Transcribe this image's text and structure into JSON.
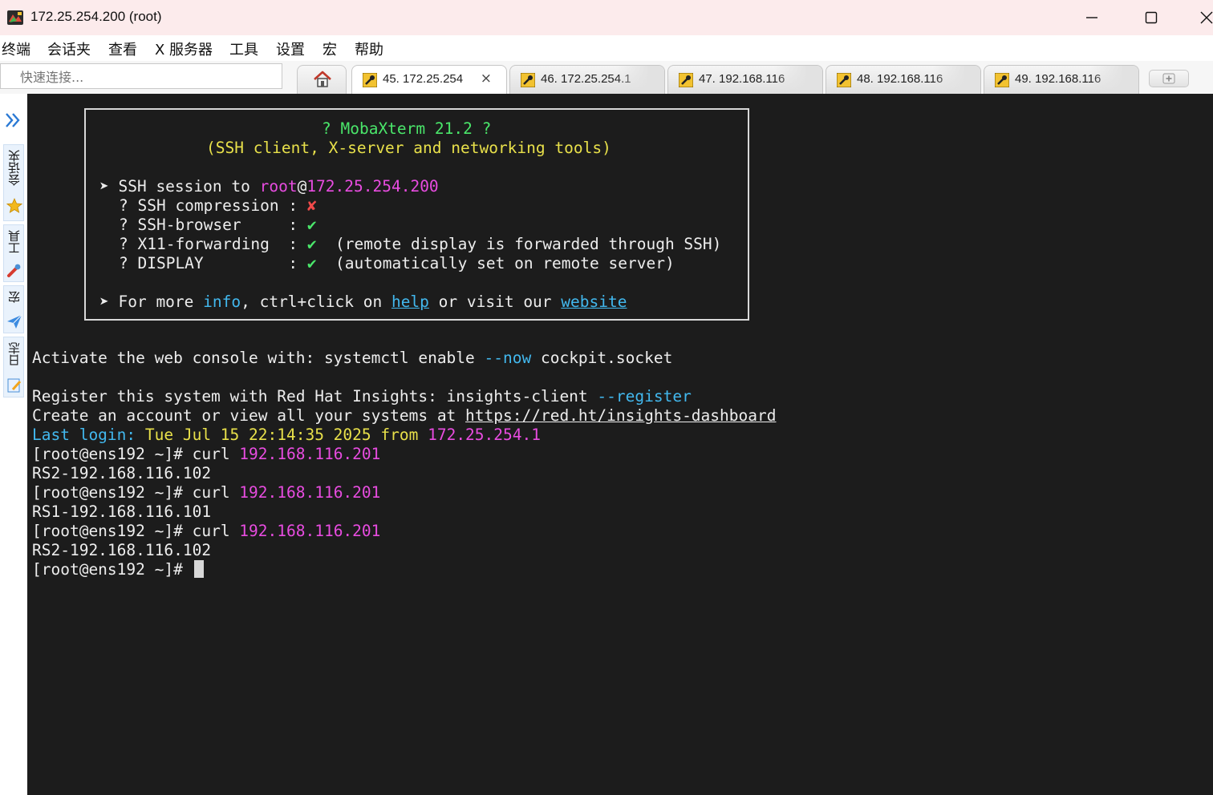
{
  "window": {
    "title": "172.25.254.200 (root)"
  },
  "menu": [
    "终端",
    "会话夹",
    "查看",
    "X 服务器",
    "工具",
    "设置",
    "宏",
    "帮助"
  ],
  "quick_connect": {
    "placeholder": "快速连接..."
  },
  "tabs": [
    {
      "label": "45. 172.25.254",
      "active": true,
      "close": "×"
    },
    {
      "label": "46. 172.25.254.1",
      "active": false
    },
    {
      "label": "47. 192.168.116",
      "active": false
    },
    {
      "label": "48. 192.168.116",
      "active": false
    },
    {
      "label": "49. 192.168.116",
      "active": false
    }
  ],
  "sidebar": {
    "sessions_label": "会话夹",
    "tools_label": "工具",
    "macros_label": "宏",
    "log_label": "日志"
  },
  "banner": {
    "title": "? MobaXterm 21.2 ?",
    "subtitle": "(SSH client, X-server and networking tools)",
    "ssh_prefix": "➤ SSH session to ",
    "ssh_user": "root",
    "ssh_at": "@",
    "ssh_host": "172.25.254.200",
    "features": [
      {
        "name": "? SSH compression : ",
        "mark": "✘",
        "note": ""
      },
      {
        "name": "? SSH-browser     : ",
        "mark": "✔",
        "note": ""
      },
      {
        "name": "? X11-forwarding  : ",
        "mark": "✔",
        "note": "  (remote display is forwarded through SSH)"
      },
      {
        "name": "? DISPLAY         : ",
        "mark": "✔",
        "note": "  (automatically set on remote server)"
      }
    ],
    "more_prefix": "➤ For more ",
    "more_info": "info",
    "more_mid": ", ctrl+click on ",
    "more_help": "help",
    "more_mid2": " or visit our ",
    "more_website": "website"
  },
  "terminal": {
    "activate_prefix": "Activate the web console with: systemctl enable ",
    "activate_flag": "--now",
    "activate_suffix": " cockpit.socket",
    "register_prefix": "Register this system with Red Hat Insights: insights-client ",
    "register_flag": "--register",
    "account_prefix": "Create an account or view all your systems at ",
    "account_url": "https://red.ht/insights-dashboard",
    "last_login_label": "Last login:",
    "last_login_time": " Tue Jul 15 22:14:35 2025 from ",
    "last_login_ip": "172.25.254.1",
    "prompt": "[root@ens192 ~]# ",
    "command": "curl ",
    "target": "192.168.116.201",
    "outputs": [
      "RS2-192.168.116.102",
      "RS1-192.168.116.101",
      "RS2-192.168.116.102"
    ]
  },
  "colors": {
    "terminal_bg": "#1c1c1c",
    "green": "#4ae66a",
    "yellow": "#e8e04a",
    "magenta": "#e84ce0",
    "cyan": "#42b8ee",
    "red": "#f04a4a"
  }
}
